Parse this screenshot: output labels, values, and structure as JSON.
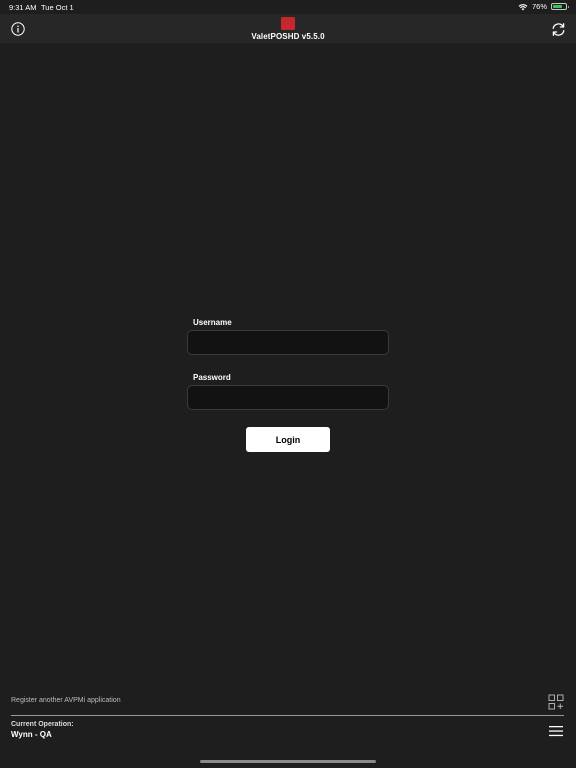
{
  "status_bar": {
    "time": "9:31 AM",
    "date": "Tue Oct 1",
    "battery": "76%",
    "battery_level": 0.76,
    "icons": [
      "wifi-icon",
      "battery-icon"
    ]
  },
  "nav": {
    "logo_text": "",
    "title": "ValetPOSHD v5.5.0",
    "icons": [
      "info-icon",
      "refresh-icon"
    ]
  },
  "login": {
    "username_label": "Username",
    "username_value": "",
    "username_placeholder": "",
    "password_label": "Password",
    "password_value": "",
    "password_placeholder": "",
    "login_button": "Login"
  },
  "footer": {
    "register_link": "Register another AVPMi application",
    "current_operation_label": "Current Operation:",
    "current_operation_value": "Wynn - QA",
    "icons": [
      "grid-add-icon",
      "menu-icon"
    ]
  },
  "colors": {
    "background": "#1e1e1e",
    "nav_background": "#272727",
    "input_background": "#121212",
    "logo_red": "#c6262d",
    "battery_green": "#35c759"
  }
}
